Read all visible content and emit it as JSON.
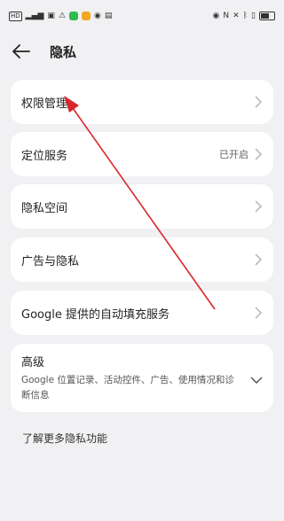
{
  "header": {
    "title": "隐私"
  },
  "menu": [
    {
      "label": "权限管理",
      "status": ""
    },
    {
      "label": "定位服务",
      "status": "已开启"
    },
    {
      "label": "隐私空间",
      "status": ""
    },
    {
      "label": "广告与隐私",
      "status": ""
    },
    {
      "label": "Google 提供的自动填充服务",
      "status": ""
    }
  ],
  "advanced": {
    "title": "高级",
    "subtitle": "Google 位置记录、活动控件、广告、使用情况和诊断信息"
  },
  "footer": {
    "link": "了解更多隐私功能"
  },
  "colors": {
    "background": "#f1f1f3",
    "card": "#ffffff",
    "annotation_arrow": "#d9262b"
  }
}
